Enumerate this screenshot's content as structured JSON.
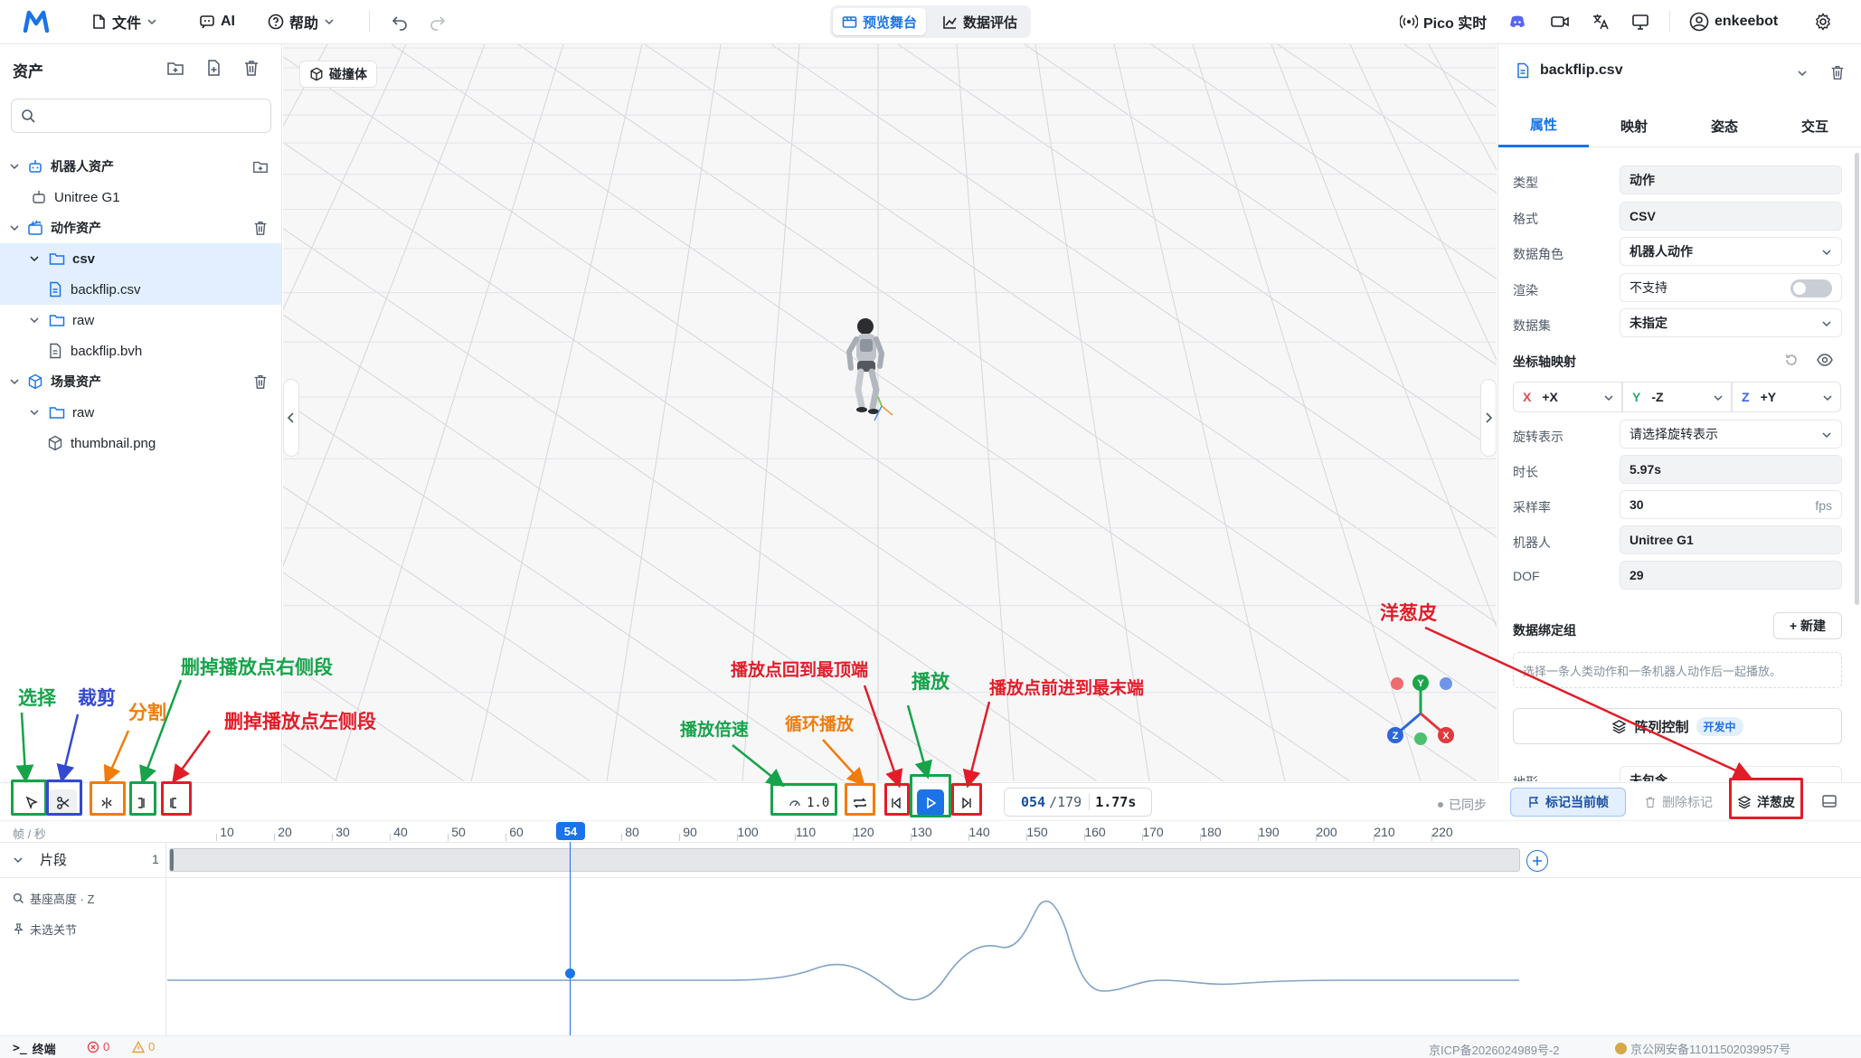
{
  "topbar": {
    "logo": "M",
    "file_menu": "文件",
    "ai_menu": "AI",
    "help_menu": "帮助",
    "tabs": [
      {
        "label": "预览舞台",
        "active": true
      },
      {
        "label": "数据评估",
        "active": false
      }
    ],
    "pico_label": "Pico 实时",
    "user": "enkeebot"
  },
  "assets": {
    "title": "资产",
    "search_placeholder": "",
    "tree": [
      {
        "label": "机器人资产",
        "level": 0,
        "kind": "group"
      },
      {
        "label": "Unitree G1",
        "level": 1,
        "kind": "robot"
      },
      {
        "label": "动作资产",
        "level": 0,
        "kind": "group"
      },
      {
        "label": "csv",
        "level": 1,
        "kind": "folder"
      },
      {
        "label": "backflip.csv",
        "level": 2,
        "kind": "file",
        "selected": true
      },
      {
        "label": "raw",
        "level": 1,
        "kind": "folder"
      },
      {
        "label": "backflip.bvh",
        "level": 2,
        "kind": "file"
      },
      {
        "label": "场景资产",
        "level": 0,
        "kind": "group"
      },
      {
        "label": "raw",
        "level": 1,
        "kind": "folder"
      },
      {
        "label": "thumbnail.png",
        "level": 2,
        "kind": "image"
      }
    ]
  },
  "viewport": {
    "collider_button": "碰撞体",
    "gizmo_axes": [
      "Y",
      "Z",
      "X"
    ]
  },
  "inspector": {
    "file_name": "backflip.csv",
    "tabs": [
      "属性",
      "映射",
      "姿态",
      "交互"
    ],
    "active_tab": "属性",
    "props": [
      {
        "label": "类型",
        "value": "动作"
      },
      {
        "label": "格式",
        "value": "CSV"
      },
      {
        "label": "数据角色",
        "value": "机器人动作"
      },
      {
        "label": "渲染",
        "value": "不支持"
      },
      {
        "label": "数据集",
        "value": "未指定"
      }
    ],
    "axis_title": "坐标轴映射",
    "axes": [
      {
        "axis": "X",
        "value": "+X",
        "color": "#e5484d"
      },
      {
        "axis": "Y",
        "value": "-Z",
        "color": "#30a46c"
      },
      {
        "axis": "Z",
        "value": "+Y",
        "color": "#3e63dd"
      }
    ],
    "props2": [
      {
        "label": "旋转表示",
        "value": "请选择旋转表示"
      },
      {
        "label": "时长",
        "value": "5.97s"
      },
      {
        "label": "采样率",
        "value": "30",
        "unit": "fps"
      },
      {
        "label": "机器人",
        "value": "Unitree G1"
      },
      {
        "label": "DOF",
        "value": "29"
      }
    ],
    "binding_title": "数据绑定组",
    "new_button": "+ 新建",
    "binding_hint": "选择一条人类动作和一条机器人动作后一起播放。",
    "array_control": "阵列控制",
    "dev_badge": "开发中",
    "cut_label": "地形",
    "cut_value": "未包含"
  },
  "timeline": {
    "speed": "1.0",
    "frame_current": "054",
    "frame_total": "/179",
    "time": "1.77s",
    "synced": "已同步",
    "mark_button": "标记当前帧",
    "delete_mark": "删除标记",
    "onion_button": "洋葱皮",
    "unit_label": "帧 / 秒",
    "ticks": [
      "10",
      "20",
      "30",
      "40",
      "50",
      "60",
      "70",
      "80",
      "90",
      "100",
      "110",
      "120",
      "130",
      "140",
      "150",
      "160",
      "170",
      "180",
      "190",
      "200",
      "210",
      "220"
    ],
    "playhead_frame": 54,
    "segment_label": "片段",
    "segment_count": "1",
    "curve_label": "基座高度 · Z",
    "joint_label": "未选关节"
  },
  "annotations": {
    "select": "选择",
    "cut": "裁剪",
    "split": "分割",
    "delete_right": "删掉播放点右侧段",
    "delete_left": "删掉播放点左侧段",
    "speed": "播放倍速",
    "loop": "循环播放",
    "to_start": "播放点回到最顶端",
    "play": "播放",
    "to_end": "播放点前进到最末端",
    "onion": "洋葱皮"
  },
  "statusbar": {
    "terminal": "终端",
    "errors": "0",
    "warnings": "0",
    "icp": "京ICP备2026024989号-2",
    "police": "京公网安备11011502039957号"
  }
}
